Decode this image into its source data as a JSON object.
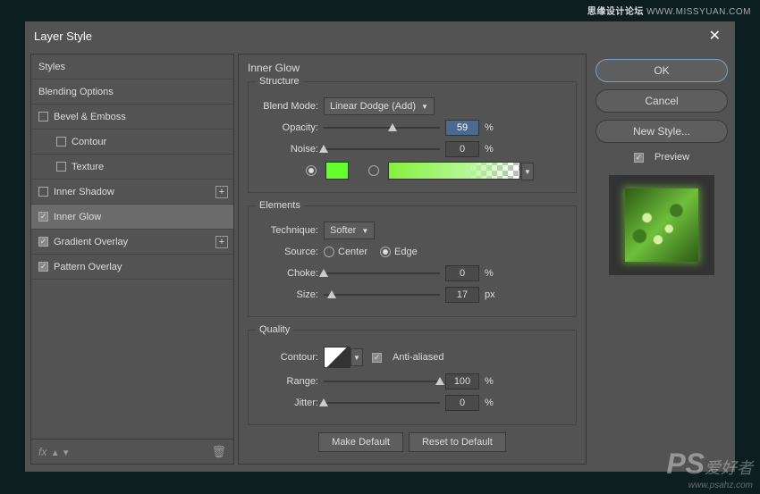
{
  "watermark": {
    "top_cn": "思缘设计论坛",
    "top_url": "WWW.MISSYUAN.COM",
    "bottom_cn": "爱好者",
    "bottom_url": "www.psahz.com"
  },
  "dialog": {
    "title": "Layer Style"
  },
  "sidebar": {
    "items": [
      {
        "label": "Styles",
        "hasCheck": false
      },
      {
        "label": "Blending Options",
        "hasCheck": false
      },
      {
        "label": "Bevel & Emboss",
        "hasCheck": true,
        "checked": false
      },
      {
        "label": "Contour",
        "hasCheck": true,
        "checked": false,
        "sub": true
      },
      {
        "label": "Texture",
        "hasCheck": true,
        "checked": false,
        "sub": true
      },
      {
        "label": "Inner Shadow",
        "hasCheck": true,
        "checked": false,
        "plus": true
      },
      {
        "label": "Inner Glow",
        "hasCheck": true,
        "checked": true,
        "selected": true
      },
      {
        "label": "Gradient Overlay",
        "hasCheck": true,
        "checked": true,
        "plus": true
      },
      {
        "label": "Pattern Overlay",
        "hasCheck": true,
        "checked": true
      }
    ],
    "fx": "fx"
  },
  "panel": {
    "title": "Inner Glow",
    "structure": {
      "legend": "Structure",
      "blendModeLabel": "Blend Mode:",
      "blendMode": "Linear Dodge (Add)",
      "opacityLabel": "Opacity:",
      "opacity": "59",
      "opacityUnit": "%",
      "noiseLabel": "Noise:",
      "noise": "0",
      "noiseUnit": "%",
      "color": "#64ff2d"
    },
    "elements": {
      "legend": "Elements",
      "techniqueLabel": "Technique:",
      "technique": "Softer",
      "sourceLabel": "Source:",
      "sourceCenter": "Center",
      "sourceEdge": "Edge",
      "chokeLabel": "Choke:",
      "choke": "0",
      "chokeUnit": "%",
      "sizeLabel": "Size:",
      "size": "17",
      "sizeUnit": "px"
    },
    "quality": {
      "legend": "Quality",
      "contourLabel": "Contour:",
      "antiAliased": "Anti-aliased",
      "rangeLabel": "Range:",
      "range": "100",
      "rangeUnit": "%",
      "jitterLabel": "Jitter:",
      "jitter": "0",
      "jitterUnit": "%"
    },
    "makeDefault": "Make Default",
    "resetDefault": "Reset to Default"
  },
  "right": {
    "ok": "OK",
    "cancel": "Cancel",
    "newStyle": "New Style...",
    "preview": "Preview"
  }
}
